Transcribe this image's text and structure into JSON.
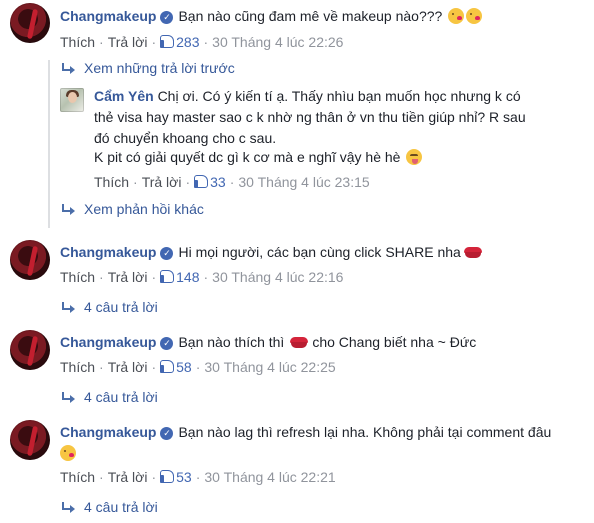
{
  "comments": [
    {
      "author": "Changmakeup",
      "text": "Bạn nào cũng đam mê về makeup nào???",
      "actions": {
        "like": "Thích",
        "reply": "Trả lời",
        "likes": "283",
        "date": "30 Tháng 4 lúc 22:26"
      },
      "previous_replies": "Xem những trả lời trước",
      "reply": {
        "author": "Cẩm Yên",
        "lines": [
          "Chị ơi. Có ý kiến tí ạ. Thấy nhìu bạn muốn học nhưng k có",
          "thẻ visa hay master sao c k nhờ ng thân ở vn thu tiền giúp nhỉ? R sau",
          "đó chuyển khoang cho c sau.",
          "K pit có giải quyết dc gì k cơ mà e nghĩ vậy hè hè"
        ],
        "actions": {
          "like": "Thích",
          "reply": "Trả lời",
          "likes": "33",
          "date": "30 Tháng 4 lúc 23:15"
        }
      },
      "more_replies": "Xem phản hồi khác"
    },
    {
      "author": "Changmakeup",
      "text": "Hi mọi người, các bạn cùng click SHARE nha",
      "actions": {
        "like": "Thích",
        "reply": "Trả lời",
        "likes": "148",
        "date": "30 Tháng 4 lúc 22:16"
      },
      "replies": "4 câu trả lời"
    },
    {
      "author": "Changmakeup",
      "text_before": "Bạn nào thích thì",
      "text_after": "cho Chang biết nha ~ Đức",
      "actions": {
        "like": "Thích",
        "reply": "Trả lời",
        "likes": "58",
        "date": "30 Tháng 4 lúc 22:25"
      },
      "replies": "4 câu trả lời"
    },
    {
      "author": "Changmakeup",
      "text": "Bạn nào lag thì refresh lại nha. Không phải tại comment đâu",
      "actions": {
        "like": "Thích",
        "reply": "Trả lời",
        "likes": "53",
        "date": "30 Tháng 4 lúc 22:21"
      },
      "replies": "4 câu trả lời"
    }
  ],
  "colors": {
    "author": "#365899",
    "meta": "#90949c",
    "like_accent": "#4267b2",
    "verified": "#4267b2"
  }
}
